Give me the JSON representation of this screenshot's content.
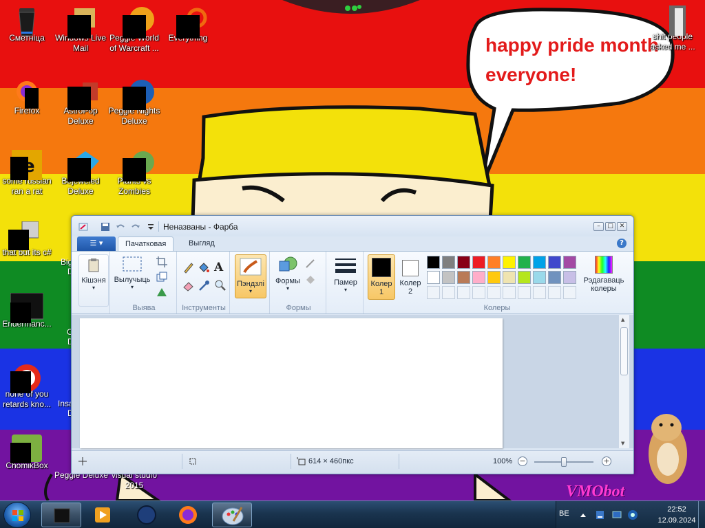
{
  "desktop": {
    "speech_bubble_text": "happy pride month everyone!",
    "watermark_text": "VMObot",
    "icons": [
      {
        "label": "Сметніца"
      },
      {
        "label": "Windows Live Mail"
      },
      {
        "label": "Peggle World of Warcraft ..."
      },
      {
        "label": "Everything"
      },
      {
        "label": "Firefox"
      },
      {
        "label": "AstroPop Deluxe"
      },
      {
        "label": "Peggle Nights Deluxe"
      },
      {
        "label": "some russian ran a rat"
      },
      {
        "label": "Bejeweled Deluxe"
      },
      {
        "label": "Plants vs Zombies"
      },
      {
        "label": "that but its c#"
      },
      {
        "label": "Endermanc..."
      },
      {
        "label": "none of you retards kno..."
      },
      {
        "label": "ChomikBox"
      },
      {
        "label": "Peggle Deluxe"
      },
      {
        "label": "visual studio 2015"
      },
      {
        "label": "shit people asked me ..."
      }
    ],
    "partial_icon_labels": [
      "Big",
      "D",
      "C",
      "D",
      "Insa",
      "D"
    ]
  },
  "paint": {
    "title": "Неназваны - Фарба",
    "app_menu_label": "☰",
    "tabs": [
      {
        "label": "Пачатковая",
        "active": true
      },
      {
        "label": "Выгляд",
        "active": false
      }
    ],
    "help_label": "?",
    "ribbon": {
      "clipboard": {
        "button": "Кішэня"
      },
      "image": {
        "button": "Вылучыць",
        "group": "Выява"
      },
      "tools": {
        "group": "Інструменты",
        "text_tool": "A"
      },
      "brushes": {
        "button": "Пэндзлі"
      },
      "shapes": {
        "button": "Формы",
        "group": "Формы"
      },
      "size": {
        "button": "Памер"
      },
      "colors": {
        "color1": {
          "label_line1": "Колер",
          "label_line2": "1",
          "value": "#000000"
        },
        "color2": {
          "label_line1": "Колер",
          "label_line2": "2",
          "value": "#ffffff"
        },
        "edit": {
          "label_line1": "Рэдагаваць",
          "label_line2": "колеры"
        },
        "group": "Колеры",
        "palette_row1": [
          "#000000",
          "#7f7f7f",
          "#880015",
          "#ed1c24",
          "#ff7f27",
          "#fff200",
          "#22b14c",
          "#00a2e8",
          "#3f48cc",
          "#a349a4"
        ],
        "palette_row2": [
          "#ffffff",
          "#c3c3c3",
          "#b97a57",
          "#ffaec9",
          "#ffc90e",
          "#efe4b0",
          "#b5e61d",
          "#99d9ea",
          "#7092be",
          "#c8bfe7"
        ]
      }
    },
    "status": {
      "canvas_size": "614 × 460пкс",
      "zoom": "100%",
      "zoom_minus": "−",
      "zoom_plus": "+",
      "zoom_level": 0.5
    },
    "window_buttons": {
      "minimize": "–",
      "maximize": "□",
      "close": "✕"
    }
  },
  "taskbar": {
    "language": "BE",
    "time": "22:52",
    "date": "12.09.2024",
    "apps": [
      {
        "name": "recycle-bin-app-icon",
        "active": true
      },
      {
        "name": "media-player-app-icon",
        "active": false
      },
      {
        "name": "globe-app-icon",
        "active": false
      },
      {
        "name": "firefox-app-icon",
        "active": false
      },
      {
        "name": "paint-app-icon",
        "active": true
      }
    ]
  }
}
